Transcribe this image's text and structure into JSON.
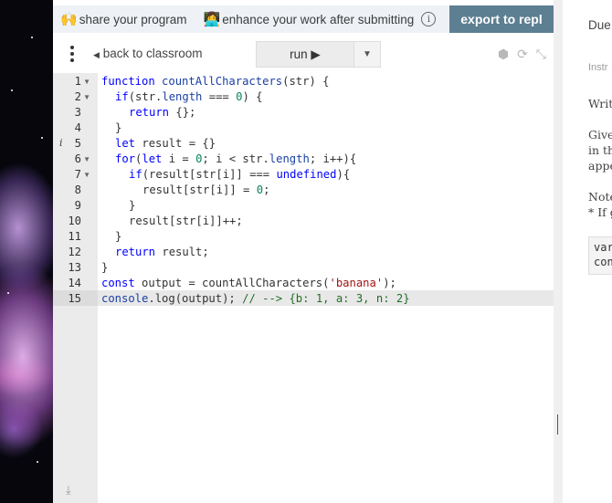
{
  "banner": {
    "share_label": "share your program",
    "enhance_label": "enhance your work after submitting",
    "share_emoji": "🙌",
    "enhance_emoji": "👩‍💻",
    "info_icon": "ⓘ",
    "export_label": "export to repl"
  },
  "toolbar": {
    "back_label": "back to classroom",
    "run_label": "run ▶"
  },
  "editor": {
    "line_numbers": [
      "1",
      "2",
      "3",
      "4",
      "5",
      "6",
      "7",
      "8",
      "9",
      "10",
      "11",
      "12",
      "13",
      "14",
      "15"
    ]
  },
  "right_panel": {
    "due": "Due",
    "instructions": "Instr",
    "write": "Writ",
    "given_1": "Give",
    "given_2": "in th",
    "given_3": "appe",
    "note_1": "Note",
    "note_2": "* If g",
    "code_1": "var",
    "code_2": "con"
  },
  "colors": {
    "export_button": "#5c7f92",
    "banner_bg": "#eef2f7",
    "gutter_bg": "#ebebeb"
  }
}
